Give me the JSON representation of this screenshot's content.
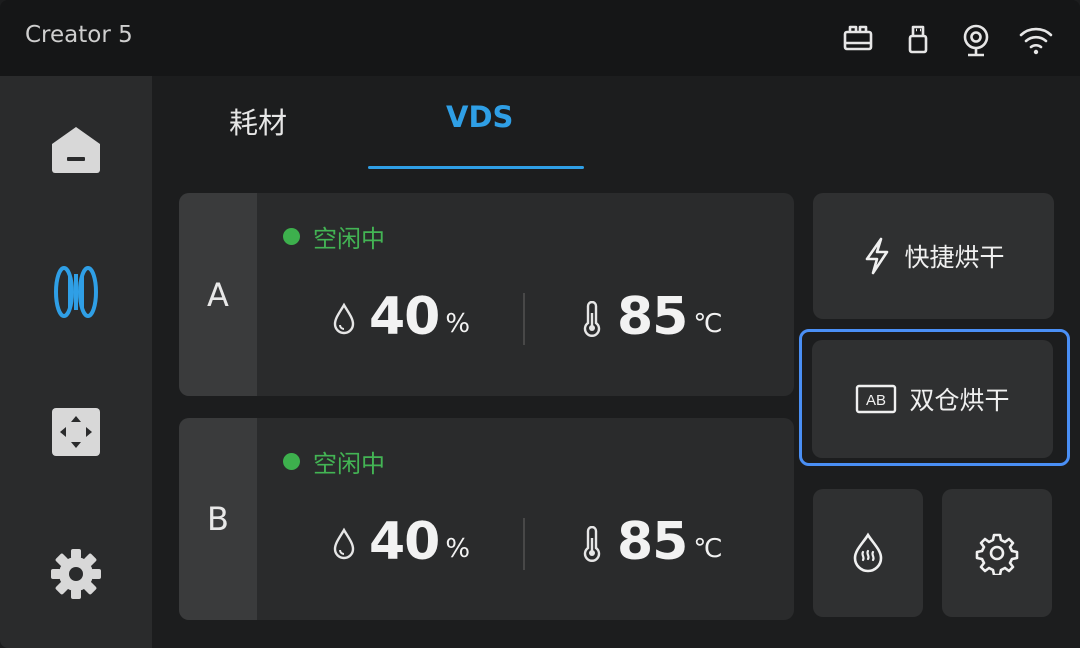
{
  "app": {
    "title": "Creator 5"
  },
  "status_icons": [
    "printhead-icon",
    "usb-icon",
    "camera-icon",
    "wifi-icon"
  ],
  "sidebar": {
    "items": [
      "home-icon",
      "filament-spool-icon",
      "move-axis-icon",
      "settings-icon"
    ],
    "active": "filament-spool-icon"
  },
  "tabs": [
    {
      "label": "耗材",
      "active": false
    },
    {
      "label": "VDS",
      "active": true
    }
  ],
  "slots": [
    {
      "id": "A",
      "status": "空闲中",
      "humidity": "40",
      "humidity_unit": "%",
      "temperature": "85",
      "temperature_unit": "℃"
    },
    {
      "id": "B",
      "status": "空闲中",
      "humidity": "40",
      "humidity_unit": "%",
      "temperature": "85",
      "temperature_unit": "℃"
    }
  ],
  "actions": {
    "quick_dry": "快捷烘干",
    "dual_dry": "双仓烘干",
    "dual_dry_icon_text": "AB"
  },
  "colors": {
    "accent": "#2f9fe6",
    "status_idle": "#43b454",
    "focus_outline": "#4a8ff5"
  }
}
